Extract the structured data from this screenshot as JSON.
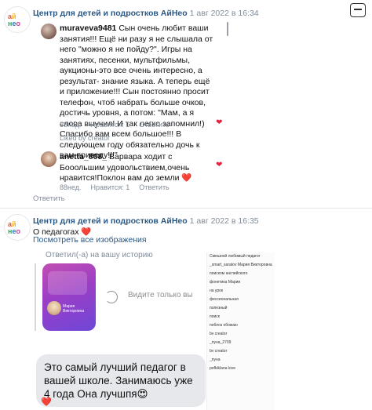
{
  "post1": {
    "author": "Центр для детей и подростков АйНео",
    "date": "1 авг 2022 в 16:34",
    "logo_text": "айнео",
    "comment1": {
      "username": "muraveva9481",
      "text": "Сын очень любит ваши занятия!!! Ещё ни разу я не слышала от него \"можно я не пойду?\". Игры на занятиях, песенки, мультфильмы, аукционы-это все очень интересно, а результат- знание языка. А теперь ещё и приложение!!! Сын постоянно просит телефон, чтоб набрать больше очков, достичь уровня, а потом: \"Мам, а я слова выучил! И так легко запомнил!) Спасибо вам всем большое!!! В следующем году обязательно дочь к вам приведу!!!\"",
      "weeks": "88нед.",
      "likes": "Нравится: 1",
      "reply": "Ответить",
      "liked_by": "Liked by creator"
    },
    "comment2": {
      "username": "anetta_808_",
      "text": "Варвара ходит с Бооольшим удовольствием,очень нравится!Поклон вам до земли",
      "emoji": "❤️",
      "weeks": "88нед.",
      "likes": "Нравится: 1",
      "reply": "Ответить"
    },
    "footer_reply": "Ответить"
  },
  "post2": {
    "author": "Центр для детей и подростков АйНео",
    "date": "1 авг 2022 в 16:35",
    "logo_text": "айнео",
    "text": "О педагогах",
    "text_emoji": "❤️",
    "view_all": "Посмотреть все изображения",
    "story_label": "Ответил(-а) на вашу историю",
    "view_only": "Видите только вы",
    "story_teacher": "Мария Викторовна",
    "bubble_text": "Это самый лучший педагог в вашей школе. Занимаюсь уже 4 года Она лучшпя😍",
    "bubble_emoji": "❤️",
    "thumb_lines": [
      "Смешной любимый педагог",
      "_smart_saratov Мария Викторовна",
      "поиском английского",
      "фонетика Марии",
      "на урок",
      "фессиональная",
      "полезный",
      "поиск",
      "поблоз обожаю",
      "bv creator",
      "_пуна_2709",
      "bv creator",
      "_пуна",
      "pofkiklana love"
    ]
  },
  "colors": {
    "link": "#2a5885",
    "meta": "#818c99",
    "heart": "#e0243f",
    "bubble": "#e7e8ec",
    "story_gradient_start": "#c24fb3",
    "story_gradient_end": "#6f47d8"
  },
  "icons": [
    "menu-icon",
    "heart-icon",
    "replay-icon",
    "logo-icon"
  ]
}
